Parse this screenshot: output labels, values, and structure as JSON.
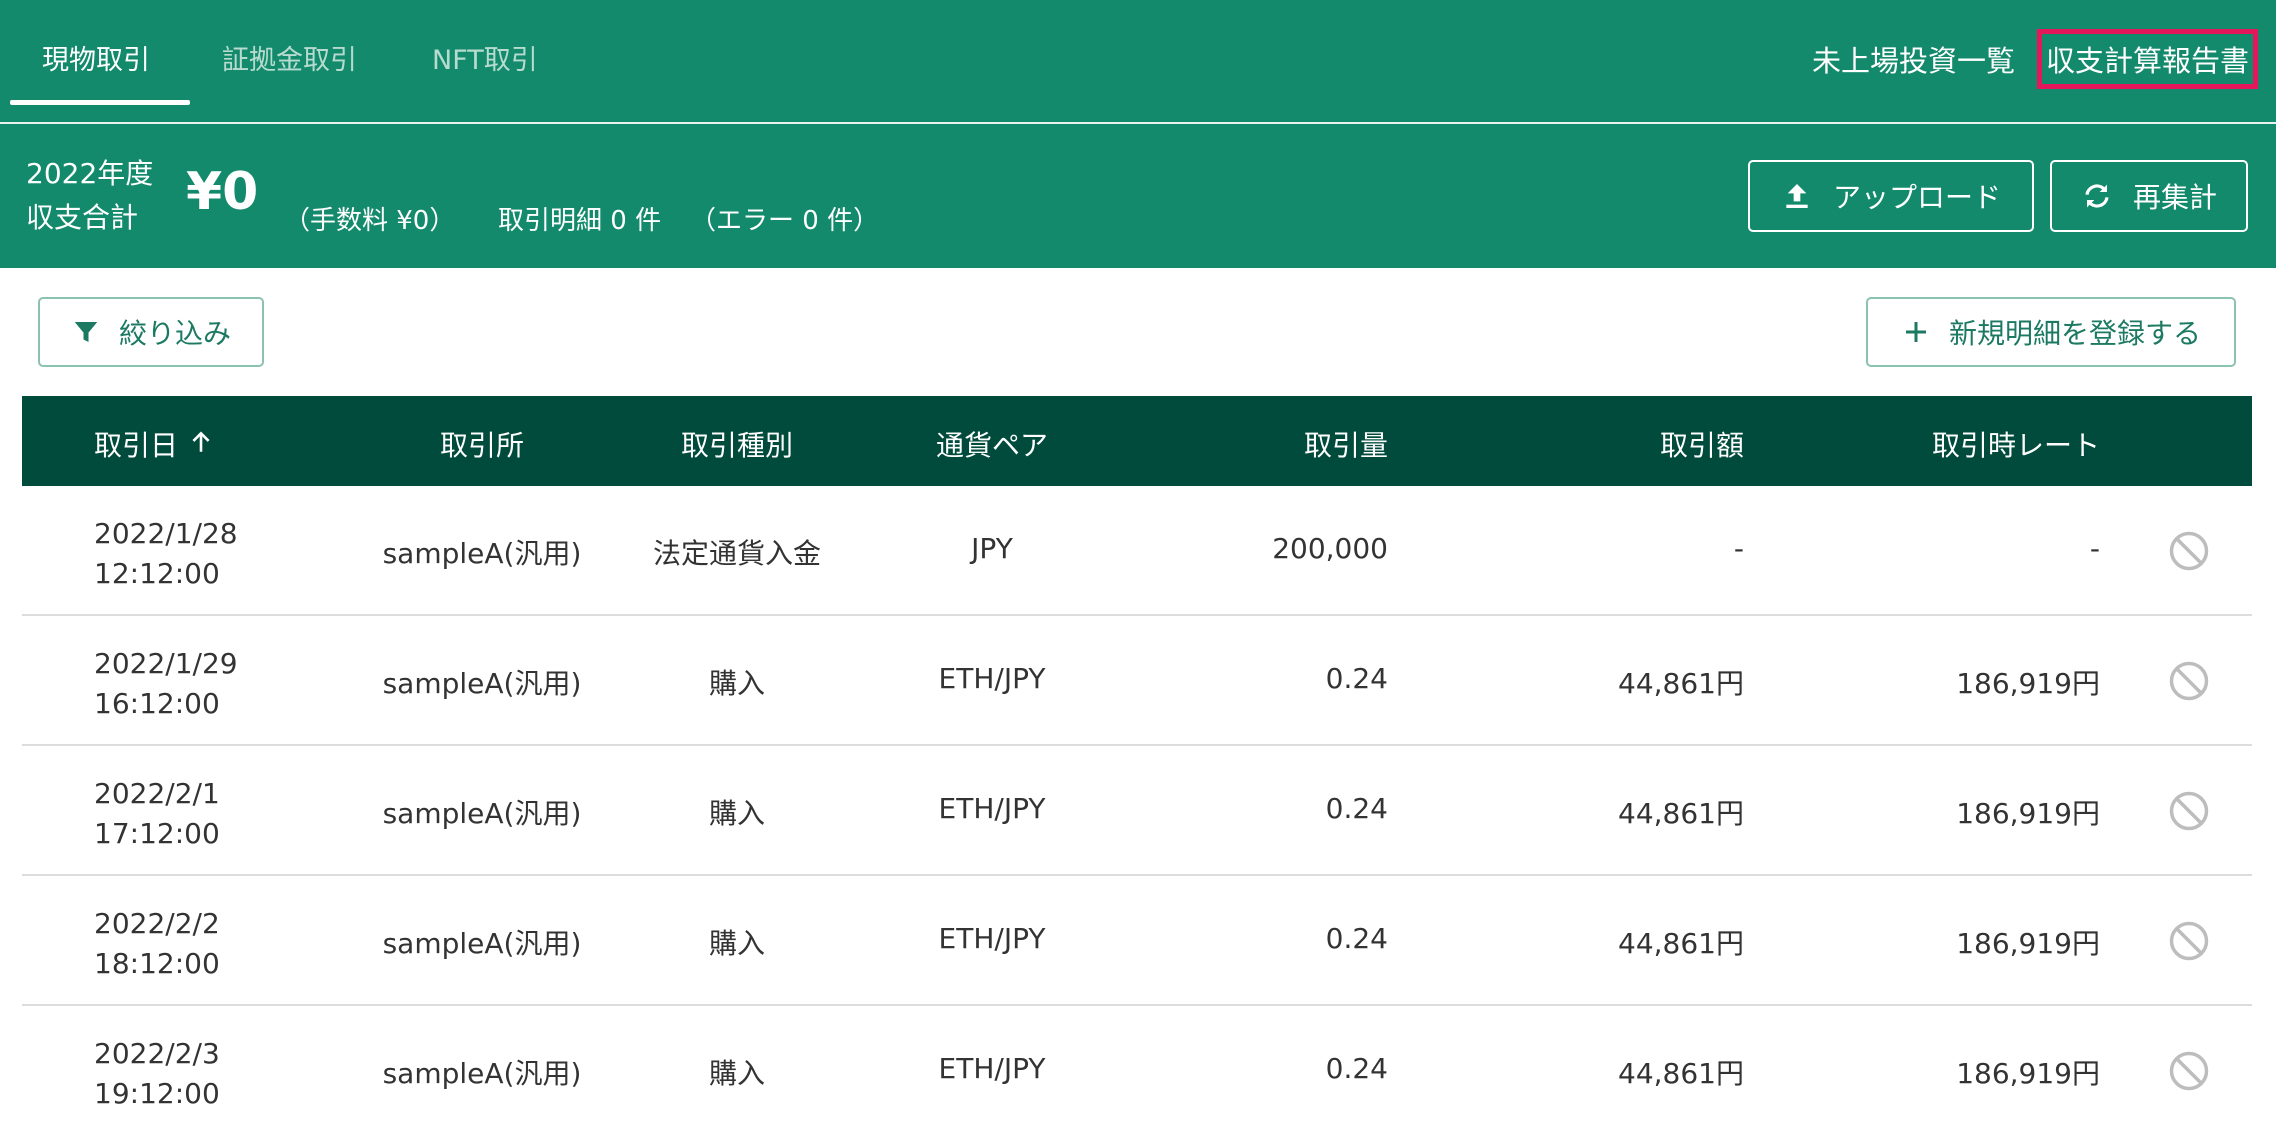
{
  "nav": {
    "tabs": [
      {
        "label": "現物取引",
        "active": true
      },
      {
        "label": "証拠金取引",
        "active": false
      },
      {
        "label": "NFT取引",
        "active": false
      }
    ],
    "links": [
      {
        "label": "未上場投資一覧"
      },
      {
        "label": "収支計算報告書",
        "highlighted": true
      }
    ]
  },
  "summary": {
    "year": "2022年度",
    "total_label": "収支合計",
    "total_value": "¥0",
    "fee": "（手数料 ¥0）",
    "detail_count": "取引明細 0 件",
    "error_count": "（エラー 0 件）",
    "upload_label": "アップロード",
    "recalc_label": "再集計"
  },
  "toolbar": {
    "filter_label": "絞り込み",
    "add_label": "新規明細を登録する"
  },
  "table": {
    "headers": {
      "date": "取引日",
      "exchange": "取引所",
      "type": "取引種別",
      "pair": "通貨ペア",
      "amount": "取引量",
      "value": "取引額",
      "rate": "取引時レート"
    },
    "rows": [
      {
        "date": "2022/1/28",
        "time": "12:12:00",
        "exchange": "sampleA(汎用)",
        "type": "法定通貨入金",
        "pair": "JPY",
        "amount": "200,000",
        "value": "-",
        "rate": "-"
      },
      {
        "date": "2022/1/29",
        "time": "16:12:00",
        "exchange": "sampleA(汎用)",
        "type": "購入",
        "pair": "ETH/JPY",
        "amount": "0.24",
        "value": "44,861円",
        "rate": "186,919円"
      },
      {
        "date": "2022/2/1",
        "time": "17:12:00",
        "exchange": "sampleA(汎用)",
        "type": "購入",
        "pair": "ETH/JPY",
        "amount": "0.24",
        "value": "44,861円",
        "rate": "186,919円"
      },
      {
        "date": "2022/2/2",
        "time": "18:12:00",
        "exchange": "sampleA(汎用)",
        "type": "購入",
        "pair": "ETH/JPY",
        "amount": "0.24",
        "value": "44,861円",
        "rate": "186,919円"
      },
      {
        "date": "2022/2/3",
        "time": "19:12:00",
        "exchange": "sampleA(汎用)",
        "type": "購入",
        "pair": "ETH/JPY",
        "amount": "0.24",
        "value": "44,861円",
        "rate": "186,919円"
      }
    ]
  },
  "colors": {
    "primary": "#138a6c",
    "header_dark": "#004b3c",
    "highlight": "#e3175a"
  }
}
